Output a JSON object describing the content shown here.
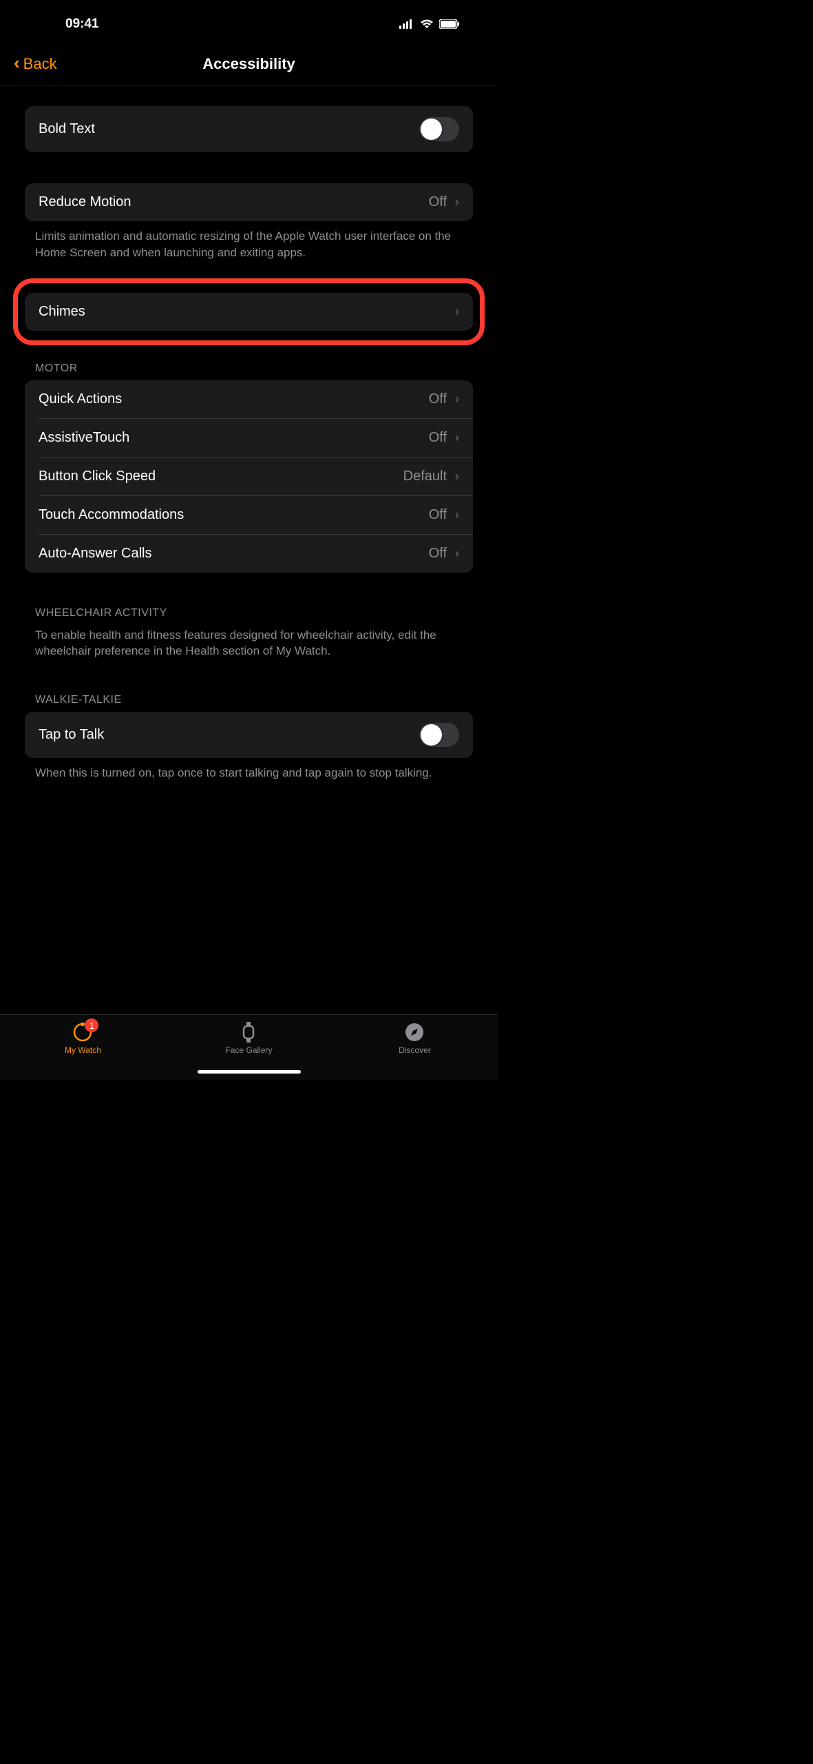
{
  "statusBar": {
    "time": "09:41"
  },
  "nav": {
    "back": "Back",
    "title": "Accessibility"
  },
  "boldText": {
    "label": "Bold Text"
  },
  "reduceMotion": {
    "label": "Reduce Motion",
    "value": "Off",
    "footer": "Limits animation and automatic resizing of the Apple Watch user interface on the Home Screen and when launching and exiting apps."
  },
  "chimes": {
    "label": "Chimes"
  },
  "motor": {
    "header": "MOTOR",
    "items": [
      {
        "label": "Quick Actions",
        "value": "Off"
      },
      {
        "label": "AssistiveTouch",
        "value": "Off"
      },
      {
        "label": "Button Click Speed",
        "value": "Default"
      },
      {
        "label": "Touch Accommodations",
        "value": "Off"
      },
      {
        "label": "Auto-Answer Calls",
        "value": "Off"
      }
    ]
  },
  "wheelchair": {
    "header": "WHEELCHAIR ACTIVITY",
    "footer": "To enable health and fitness features designed for wheelchair activity, edit the wheelchair preference in the Health section of My Watch."
  },
  "walkieTalkie": {
    "header": "WALKIE-TALKIE",
    "label": "Tap to Talk",
    "footer": "When this is turned on, tap once to start talking and tap again to stop talking."
  },
  "tabs": {
    "watch": {
      "label": "My Watch",
      "badge": "1"
    },
    "gallery": {
      "label": "Face Gallery"
    },
    "discover": {
      "label": "Discover"
    }
  }
}
